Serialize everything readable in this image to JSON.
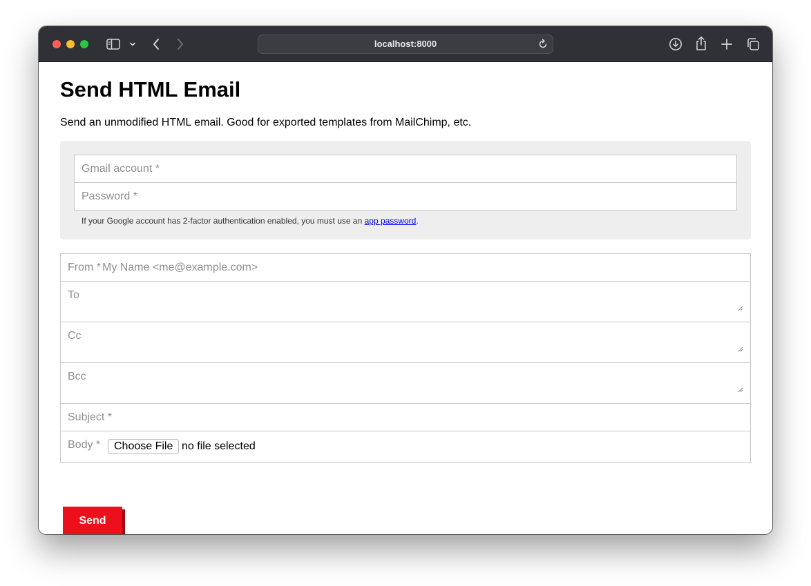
{
  "browser": {
    "url": "localhost:8000",
    "icons": [
      "close-dot",
      "minimize-dot",
      "zoom-dot",
      "sidebar-icon",
      "chevron-down-icon",
      "back-icon",
      "forward-icon",
      "reload-icon",
      "download-icon",
      "share-icon",
      "new-tab-icon",
      "tabs-overview-icon"
    ]
  },
  "page": {
    "title": "Send HTML Email",
    "intro": "Send an unmodified HTML email. Good for exported templates from MailChimp, etc."
  },
  "auth": {
    "gmail_placeholder": "Gmail account *",
    "password_placeholder": "Password *",
    "hint_prefix": "If your Google account has 2-factor authentication enabled, you must use an ",
    "hint_link": "app password",
    "hint_suffix": "."
  },
  "form": {
    "from_label": "From *",
    "from_placeholder": "My Name <me@example.com>",
    "to_label": "To",
    "cc_label": "Cc",
    "bcc_label": "Bcc",
    "subject_placeholder": "Subject *",
    "body_label": "Body *",
    "file_button": "Choose File",
    "file_status": "no file selected"
  },
  "actions": {
    "send_label": "Send"
  },
  "colors": {
    "titlebar": "#2f3136",
    "send_button": "#ee0f1c",
    "panel": "#eeeeee",
    "link": "#0000ee"
  }
}
